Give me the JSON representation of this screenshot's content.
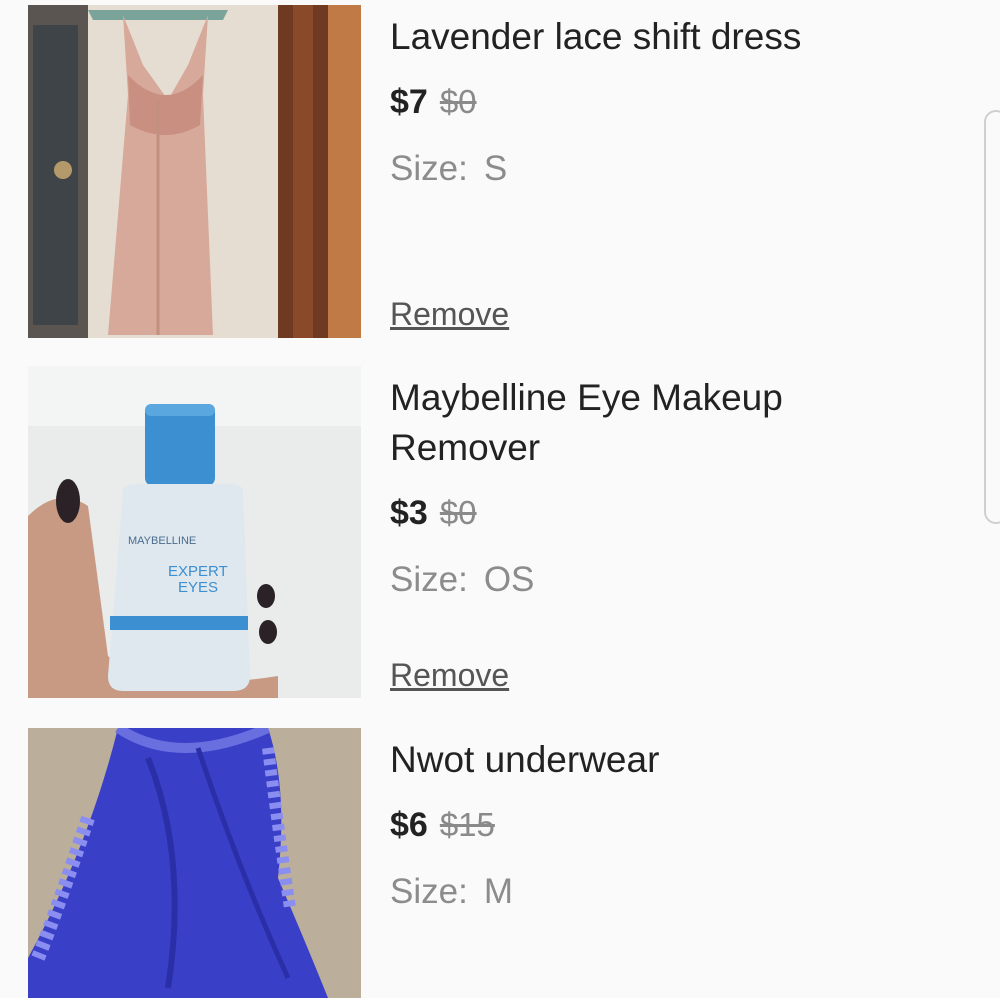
{
  "items": [
    {
      "title": "Lavender lace shift dress",
      "price": "$7",
      "original_price": "$0",
      "size_label": "Size:",
      "size_value": "S",
      "remove_label": "Remove",
      "image_icon": "dress-photo"
    },
    {
      "title_line1": "Maybelline Eye Makeup",
      "title_line2": "Remover",
      "price": "$3",
      "original_price": "$0",
      "size_label": "Size:",
      "size_value": "OS",
      "remove_label": "Remove",
      "image_icon": "makeup-remover-photo",
      "bottle_brand": "MAYBELLINE",
      "bottle_line1": "EXPERT",
      "bottle_line2": "EYES"
    },
    {
      "title": "Nwot underwear",
      "price": "$6",
      "original_price": "$15",
      "size_label": "Size:",
      "size_value": "M",
      "image_icon": "underwear-photo"
    }
  ],
  "colors": {
    "background": "#fafafa",
    "title": "#222222",
    "muted": "#8c8c8c",
    "link": "#555555"
  }
}
